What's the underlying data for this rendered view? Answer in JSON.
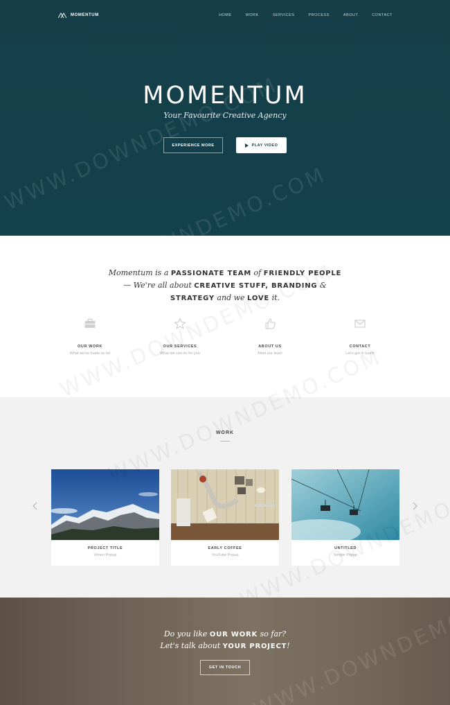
{
  "brand": {
    "name": "MOMENTUM"
  },
  "nav": {
    "items": [
      "HOME",
      "WORK",
      "SERVICES",
      "PROCESS",
      "ABOUT",
      "CONTACT"
    ]
  },
  "hero": {
    "title": "MOMENTUM",
    "subtitle": "Your Favourite Creative Agency",
    "primary_button": "EXPERIENCE MORE",
    "secondary_button": "PLAY VIDEO"
  },
  "intro": {
    "line1": {
      "a": "Momentum",
      "b": " is a ",
      "c": "PASSIONATE TEAM",
      "d": " of ",
      "e": "FRIENDLY PEOPLE"
    },
    "line2": {
      "a": "— We're all about ",
      "b": "CREATIVE STUFF, BRANDING",
      "c": " &"
    },
    "line3": {
      "a": "STRATEGY",
      "b": " and we ",
      "c": "LOVE",
      "d": " it."
    }
  },
  "features": [
    {
      "icon": "briefcase-icon",
      "title": "OUR WORK",
      "desc": "What we've made so far"
    },
    {
      "icon": "star-icon",
      "title": "OUR SERVICES",
      "desc": "What we can do for you"
    },
    {
      "icon": "thumbs-up-icon",
      "title": "ABOUT US",
      "desc": "Meet our team"
    },
    {
      "icon": "envelope-icon",
      "title": "CONTACT",
      "desc": "Let's get in touch"
    }
  ],
  "work": {
    "heading": "WORK",
    "cards": [
      {
        "title": "PROJECT TITLE",
        "sub": "Vimeo Popup"
      },
      {
        "title": "EARLY COFFEE",
        "sub": "YouTube Popup"
      },
      {
        "title": "UNTITLED",
        "sub": "Simple Popup"
      }
    ]
  },
  "cta": {
    "line1": {
      "a": "Do you like ",
      "b": "OUR WORK",
      "c": " so far?"
    },
    "line2": {
      "a": "Let's talk about ",
      "b": "YOUR PROJECT",
      "c": "!"
    },
    "button": "GET IN TOUCH"
  },
  "watermark": "WWW.DOWNDEMO.COM",
  "colors": {
    "hero_bg": "#163e49",
    "work_bg": "#f2f2f2",
    "cta_bg": "#7e7263"
  }
}
